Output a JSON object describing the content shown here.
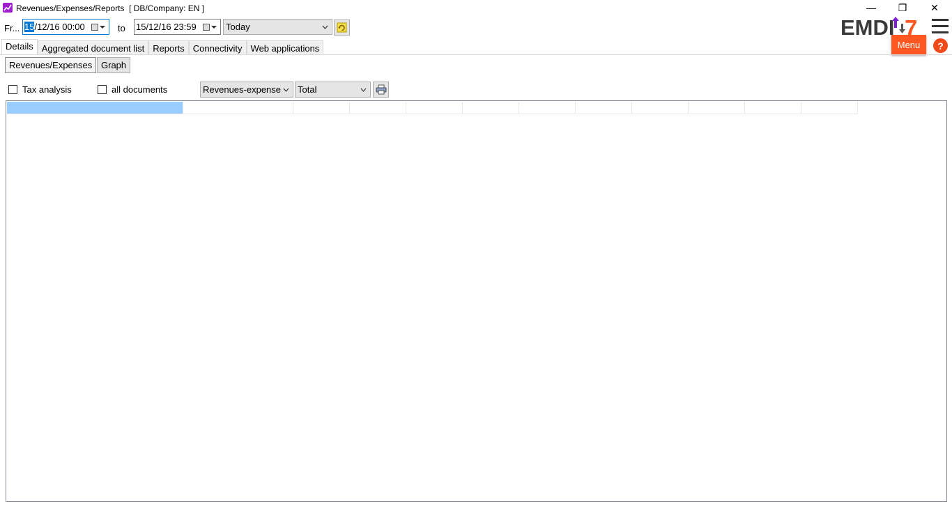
{
  "window": {
    "title": "Revenues/Expenses/Reports",
    "db_company": "[ DB/Company: EN ]",
    "minimize": "—",
    "restore": "❐",
    "close": "✕"
  },
  "toolbar": {
    "from_label": "Fr...",
    "from_date_selected": "15",
    "from_date_rest": "/12/16 00:00",
    "to_label": "to",
    "to_date": "15/12/16 23:59",
    "period_value": "Today"
  },
  "brand": {
    "logo_text": "EMDI",
    "logo_number": "7",
    "menu_label": "Menu",
    "help_label": "?",
    "accent_color": "#ff5722"
  },
  "tabs": [
    {
      "label": "Details",
      "active": true
    },
    {
      "label": "Aggregated document list"
    },
    {
      "label": "Reports"
    },
    {
      "label": "Connectivity"
    },
    {
      "label": "Web applications"
    }
  ],
  "subtabs": [
    {
      "label": "Revenues/Expenses",
      "active": true
    },
    {
      "label": "Graph"
    }
  ],
  "filters": {
    "tax_analysis_label": "Tax analysis",
    "all_documents_label": "all documents",
    "type_value": "Revenues-expense",
    "aggregate_value": "Total"
  },
  "icons": {
    "refresh": "refresh-icon",
    "print": "printer-icon",
    "calendar": "calendar-icon"
  }
}
